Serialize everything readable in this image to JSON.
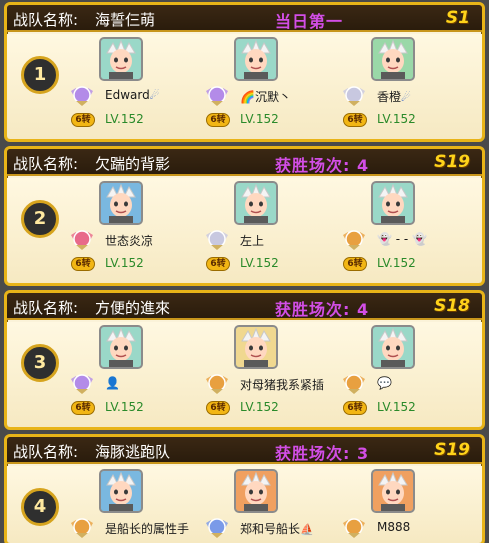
{
  "teams": [
    {
      "label": "战队名称:",
      "name": "海誓仨萌",
      "result": "当日第一",
      "server": "S1",
      "rank": "1",
      "members": [
        {
          "name": "Edward",
          "suffix": "☄",
          "emblem_num": "13",
          "tier": "6转",
          "level": "LV.152",
          "emblem_color": "#b38be8",
          "portrait_color": "#9ad8c8"
        },
        {
          "name": "🌈沉默丶",
          "suffix": "",
          "emblem_num": "15",
          "tier": "6转",
          "level": "LV.152",
          "emblem_color": "#b38be8",
          "portrait_color": "#9ad8c8"
        },
        {
          "name": "香橙",
          "suffix": "☄",
          "emblem_num": "",
          "tier": "6转",
          "level": "LV.152",
          "emblem_color": "#c8c8e0",
          "portrait_color": "#9ad8a8"
        }
      ]
    },
    {
      "label": "战队名称:",
      "name": "欠踹的背影",
      "result": "获胜场次: 4",
      "server": "S19",
      "rank": "2",
      "members": [
        {
          "name": "世态炎凉",
          "suffix": "",
          "emblem_num": "17",
          "tier": "6转",
          "level": "LV.152",
          "emblem_color": "#e86a8a",
          "portrait_color": "#7ab8e0"
        },
        {
          "name": "左上",
          "suffix": "",
          "emblem_num": "",
          "tier": "6转",
          "level": "LV.152",
          "emblem_color": "#c8c8e0",
          "portrait_color": "#9ad8c8"
        },
        {
          "name": "👻 - - 👻",
          "suffix": "",
          "emblem_num": "20",
          "tier": "6转",
          "level": "LV.152",
          "emblem_color": "#e8a040",
          "portrait_color": "#9ad8c8"
        }
      ]
    },
    {
      "label": "战队名称:",
      "name": "方便的進來",
      "result": "获胜场次: 4",
      "server": "S18",
      "rank": "3",
      "members": [
        {
          "name": "👤",
          "suffix": "",
          "emblem_num": "13",
          "tier": "6转",
          "level": "LV.152",
          "emblem_color": "#b38be8",
          "portrait_color": "#9ad8c8"
        },
        {
          "name": "对母猪我系紧插",
          "suffix": "",
          "emblem_num": "12",
          "tier": "6转",
          "level": "LV.152",
          "emblem_color": "#e8a040",
          "portrait_color": "#f0d890"
        },
        {
          "name": "💬",
          "suffix": "",
          "emblem_num": "12",
          "tier": "6转",
          "level": "LV.152",
          "emblem_color": "#e8a040",
          "portrait_color": "#9ad8c8"
        }
      ]
    },
    {
      "label": "战队名称:",
      "name": "海豚逃跑队",
      "result": "获胜场次: 3",
      "server": "S19",
      "rank": "4",
      "members": [
        {
          "name": "是船长的属性手",
          "suffix": "",
          "emblem_num": "7",
          "tier": "",
          "level": "",
          "emblem_color": "#e8a040",
          "portrait_color": "#7ab8e0"
        },
        {
          "name": "郑和号船长",
          "suffix": "⛵",
          "emblem_num": "10",
          "tier": "",
          "level": "",
          "emblem_color": "#7a9ae8",
          "portrait_color": "#f0a060"
        },
        {
          "name": "M888",
          "suffix": "",
          "emblem_num": "12",
          "tier": "",
          "level": "",
          "emblem_color": "#e8a040",
          "portrait_color": "#f0a060"
        }
      ]
    }
  ]
}
